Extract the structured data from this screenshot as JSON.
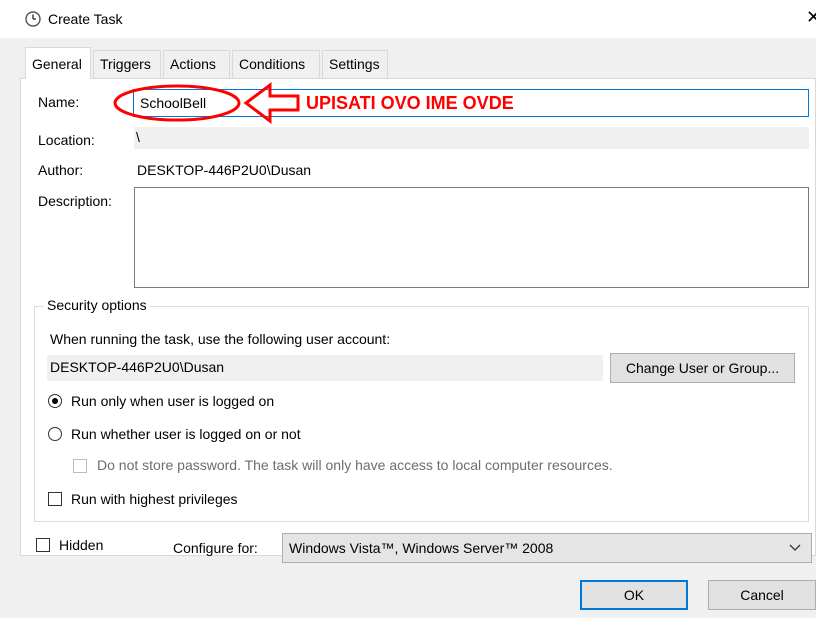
{
  "window": {
    "title": "Create Task",
    "close_glyph": "✕",
    "title_icon": "clock-icon"
  },
  "tabs": [
    {
      "label": "General",
      "active": true
    },
    {
      "label": "Triggers",
      "active": false
    },
    {
      "label": "Actions",
      "active": false
    },
    {
      "label": "Conditions",
      "active": false
    },
    {
      "label": "Settings",
      "active": false
    }
  ],
  "general": {
    "name_label": "Name:",
    "name_value": "SchoolBell",
    "location_label": "Location:",
    "location_value": "\\",
    "author_label": "Author:",
    "author_value": "DESKTOP-446P2U0\\Dusan",
    "description_label": "Description:",
    "description_value": ""
  },
  "security": {
    "title": "Security options",
    "account_prompt": "When running the task, use the following user account:",
    "account_value": "DESKTOP-446P2U0\\Dusan",
    "change_button": "Change User or Group...",
    "radio_logged_on": "Run only when user is logged on",
    "radio_logged_on_selected": true,
    "radio_whether": "Run whether user is logged on or not",
    "radio_whether_selected": false,
    "no_store_password": "Do not store password.  The task will only have access to local computer resources.",
    "highest_privileges": "Run with highest privileges"
  },
  "bottom": {
    "hidden_label": "Hidden",
    "configure_label": "Configure for:",
    "configure_value": "Windows Vista™, Windows Server™ 2008",
    "ok_button": "OK",
    "cancel_button": "Cancel"
  },
  "annotation": {
    "text": "UPISATI OVO IME OVDE",
    "color": "#ff0000"
  },
  "colors": {
    "accent": "#0078d7",
    "dialog_bg": "#f0f0f0",
    "panel_bg": "#ffffff"
  }
}
